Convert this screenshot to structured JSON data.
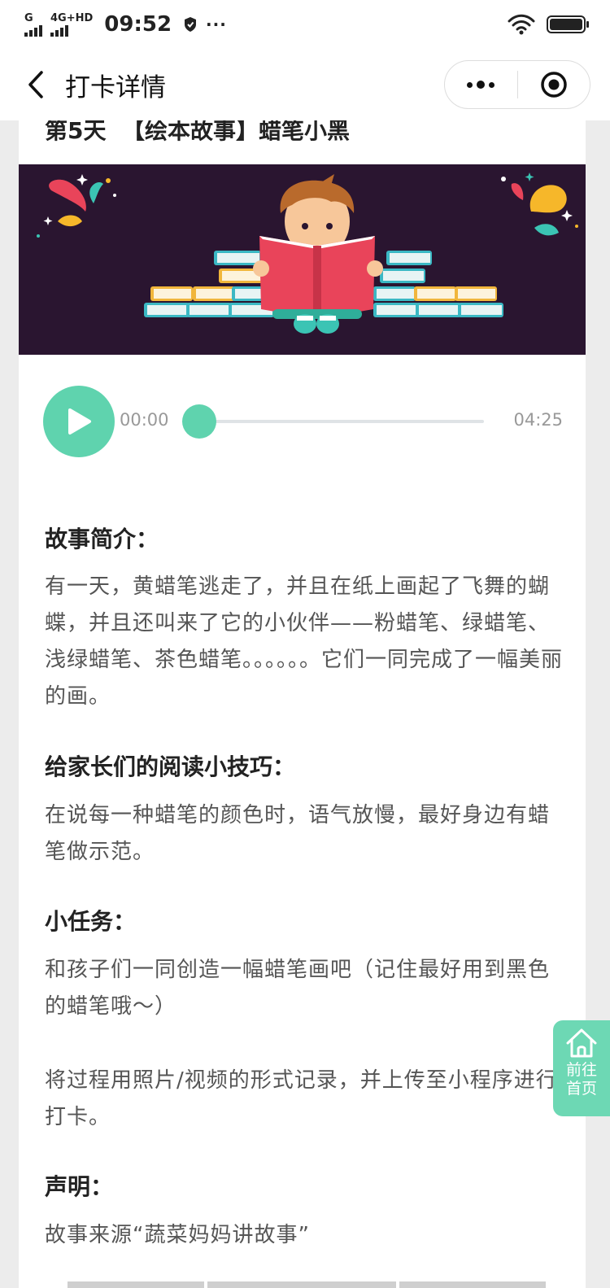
{
  "status_bar": {
    "network_top": "G",
    "network2_top": "4G+HD",
    "time": "09:52",
    "more": "···",
    "battery_level": 1.0
  },
  "nav": {
    "title": "打卡详情",
    "back_icon": "chevron-left-icon",
    "more_icon": "more-dots-icon",
    "close_icon": "target-circle-icon"
  },
  "content": {
    "day_title": "第5天  【绘本故事】蜡笔小黑",
    "banner_icon": "child-reading-illustration"
  },
  "player": {
    "current_time": "00:00",
    "total_time": "04:25",
    "progress": 0,
    "accent": "#5fd3ae"
  },
  "sections": {
    "intro_heading": "故事简介：",
    "intro_text": "有一天，黄蜡笔逃走了，并且在纸上画起了飞舞的蝴蝶，并且还叫来了它的小伙伴——粉蜡笔、绿蜡笔、浅绿蜡笔、茶色蜡笔。。。。。。它们一同完成了一幅美丽的画。",
    "tips_heading": "给家长们的阅读小技巧：",
    "tips_text": "在说每一种蜡笔的颜色时，语气放慢，最好身边有蜡笔做示范。",
    "task_heading": "小任务：",
    "task_text": "和孩子们一同创造一幅蜡笔画吧（记住最好用到黑色的蜡笔哦～）",
    "task_text2": "将过程用照片/视频的形式记录，并上传至小程序进行打卡。",
    "statement_heading": "声明：",
    "statement_text": "故事来源“蔬菜妈妈讲故事”"
  },
  "fab": {
    "label": "前往首页",
    "icon": "home-icon",
    "color": "#6dd8b4"
  }
}
